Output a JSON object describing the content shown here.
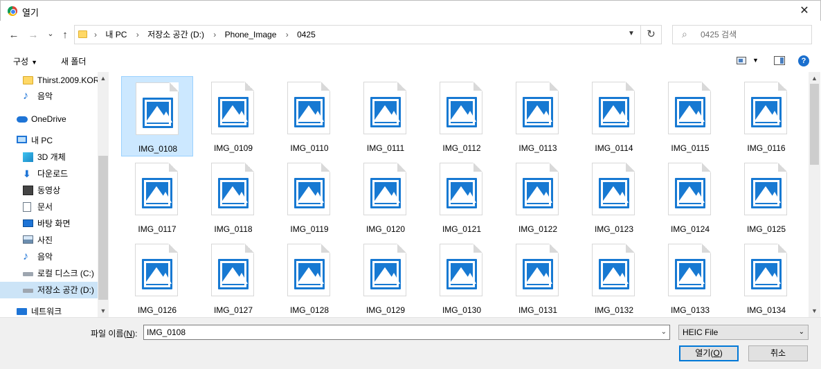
{
  "window": {
    "title": "열기",
    "close_glyph": "✕"
  },
  "nav": {
    "back_glyph": "←",
    "forward_glyph": "→",
    "recent_glyph": "⌄",
    "up_glyph": "↑",
    "breadcrumb": [
      "내 PC",
      "저장소 공간 (D:)",
      "Phone_Image",
      "0425"
    ],
    "refresh_glyph": "↻",
    "search_placeholder": "0425 검색"
  },
  "toolbar": {
    "organize_label": "구성",
    "new_folder_label": "새 폴더",
    "help_label": "?"
  },
  "sidebar": {
    "items": [
      {
        "label": "Thirst.2009.KOR",
        "icon": "folder-icon"
      },
      {
        "label": "음악",
        "icon": "music-icon"
      },
      {
        "label": "OneDrive",
        "icon": "cloud-icon"
      },
      {
        "label": "내 PC",
        "icon": "pc-icon"
      },
      {
        "label": "3D 개체",
        "icon": "cube-icon"
      },
      {
        "label": "다운로드",
        "icon": "download-icon"
      },
      {
        "label": "동영상",
        "icon": "video-icon"
      },
      {
        "label": "문서",
        "icon": "document-icon"
      },
      {
        "label": "바탕 화면",
        "icon": "desktop-icon"
      },
      {
        "label": "사진",
        "icon": "picture-icon"
      },
      {
        "label": "음악",
        "icon": "music-icon"
      },
      {
        "label": "로컬 디스크 (C:)",
        "icon": "drive-icon"
      },
      {
        "label": "저장소 공간 (D:)",
        "icon": "drive-icon"
      },
      {
        "label": "네트워크",
        "icon": "network-icon"
      }
    ],
    "selected": "저장소 공간 (D:)"
  },
  "files": [
    "IMG_0108",
    "IMG_0109",
    "IMG_0110",
    "IMG_0111",
    "IMG_0112",
    "IMG_0113",
    "IMG_0114",
    "IMG_0115",
    "IMG_0116",
    "IMG_0117",
    "IMG_0118",
    "IMG_0119",
    "IMG_0120",
    "IMG_0121",
    "IMG_0122",
    "IMG_0123",
    "IMG_0124",
    "IMG_0125",
    "IMG_0126",
    "IMG_0127",
    "IMG_0128",
    "IMG_0129",
    "IMG_0130",
    "IMG_0131",
    "IMG_0132",
    "IMG_0133",
    "IMG_0134"
  ],
  "selected_file": "IMG_0108",
  "footer": {
    "filename_label": "파일 이름(",
    "filename_key": "N",
    "filename_label_end": "):",
    "filename_value": "IMG_0108",
    "filetype_value": "HEIC File",
    "open_label": "열기(",
    "open_key": "O",
    "open_label_end": ")",
    "cancel_label": "취소"
  },
  "colors": {
    "accent": "#0078d7",
    "selection": "#cce8ff",
    "image_icon": "#1779d2"
  }
}
